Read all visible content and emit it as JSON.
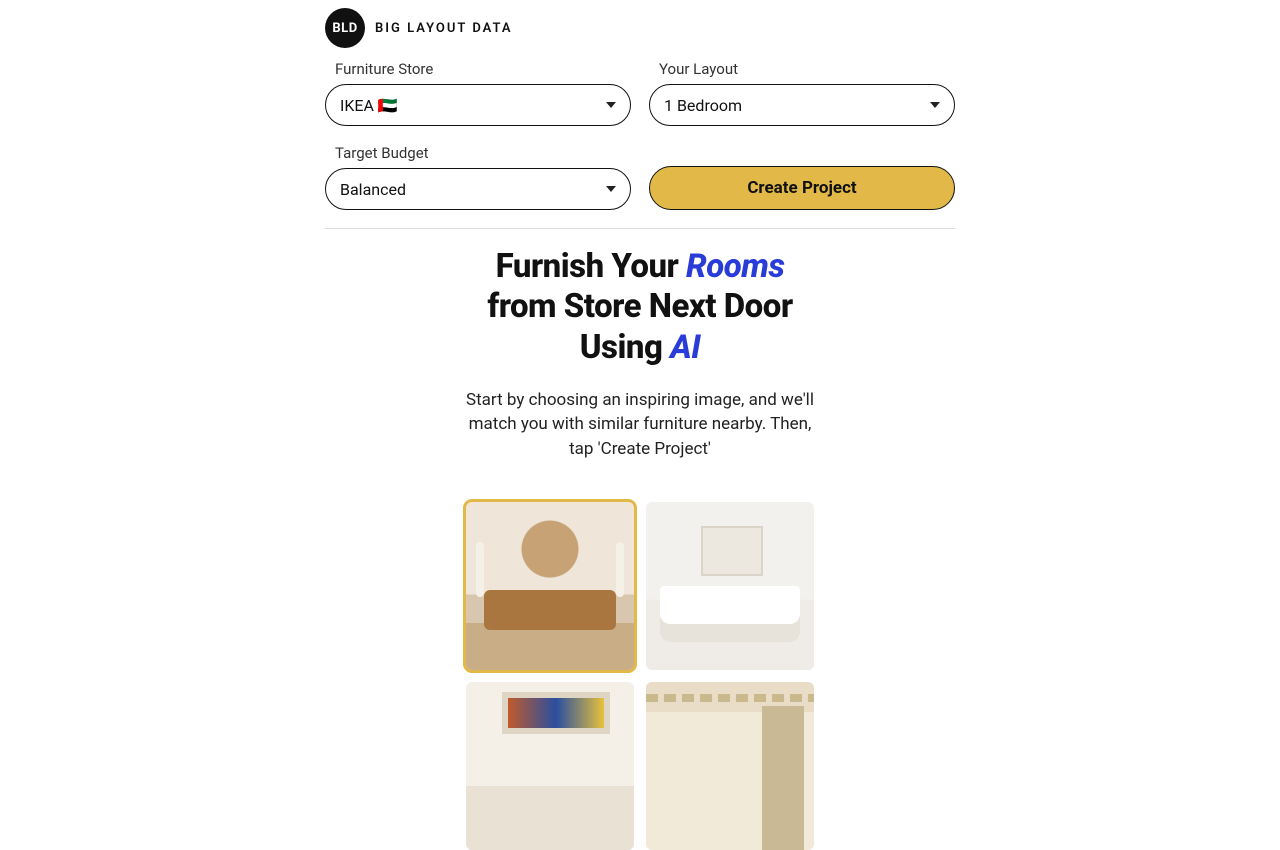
{
  "brand": {
    "badge": "BLD",
    "name": "BIG LAYOUT DATA"
  },
  "form": {
    "store": {
      "label": "Furniture Store",
      "value": "IKEA 🇦🇪"
    },
    "layout": {
      "label": "Your Layout",
      "value": "1 Bedroom"
    },
    "budget": {
      "label": "Target Budget",
      "value": "Balanced"
    },
    "cta": "Create Project"
  },
  "headline": {
    "part1": "Furnish Your ",
    "em1": "Rooms",
    "part2": "from Store Next Door",
    "part3": "Using ",
    "em2": "AI"
  },
  "subtext": "Start by choosing an inspiring image, and we'll match you with similar furniture nearby. Then, tap 'Create Project'",
  "gallery": {
    "selected_index": 0,
    "items": [
      {
        "alt": "warm living room with tan sofa"
      },
      {
        "alt": "white bedroom with large bed"
      },
      {
        "alt": "living room with colorful abstract art"
      },
      {
        "alt": "beige bedroom with wood slat accent"
      }
    ]
  }
}
